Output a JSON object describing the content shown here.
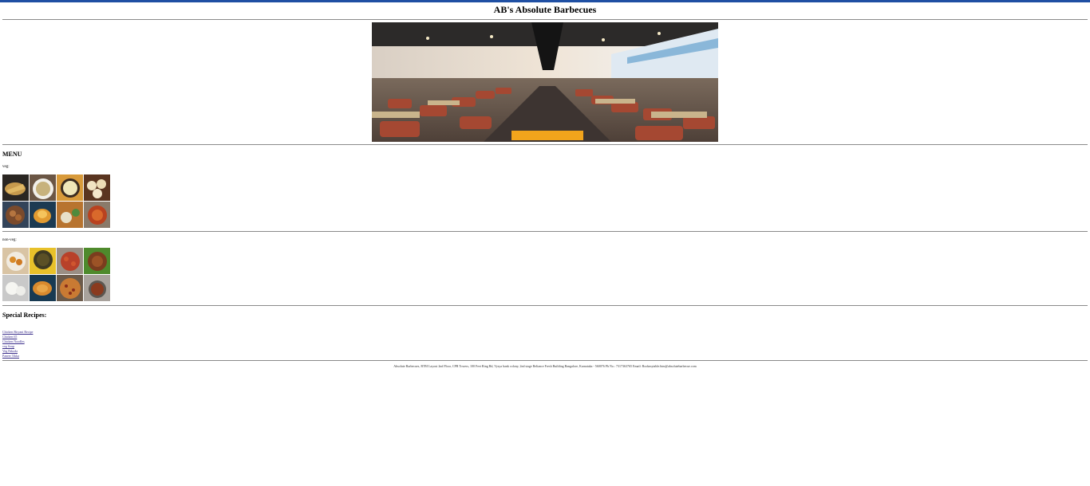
{
  "header": {
    "title": "AB's Absolute Barbecues"
  },
  "menu": {
    "heading": "MENU",
    "veg_label": "veg:",
    "nonveg_label": "non-veg:"
  },
  "special": {
    "heading": "Special Recipes:",
    "links": [
      "Chicken Biryani Recipe",
      "Chicken 65",
      "Chicken Noodles",
      "veg Soup",
      "Veg Pakoda",
      "Paneer Tikka"
    ]
  },
  "footer": {
    "text": "Absolute Barbecues, BTM Layout 2nd Floor, CPR Towers, 100 Feet Ring Rd, Vysya bank colony, 2nd stage Reliance Fresh Building Bangalore, Karnataka - 560076 Ph No.: 7317363765 Email: Bookmytable.btm@absolutebarbecue.com"
  },
  "colors": {
    "accent_bar": "#1f4fa3",
    "link": "#3a2d8a",
    "rule": "#8a8a8a"
  }
}
